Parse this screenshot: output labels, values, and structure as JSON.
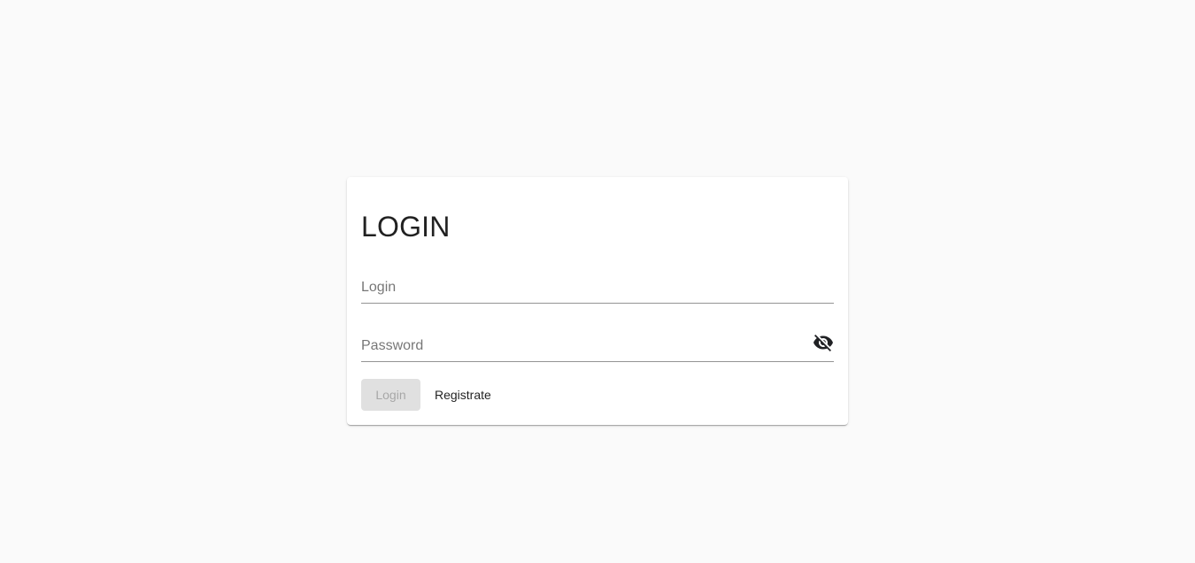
{
  "login_card": {
    "title": "LOGIN",
    "login_field": {
      "placeholder": "Login",
      "value": ""
    },
    "password_field": {
      "placeholder": "Password",
      "value": "",
      "toggle_icon": "visibility-off-icon"
    },
    "login_button_label": "Login",
    "register_button_label": "Registrate"
  }
}
